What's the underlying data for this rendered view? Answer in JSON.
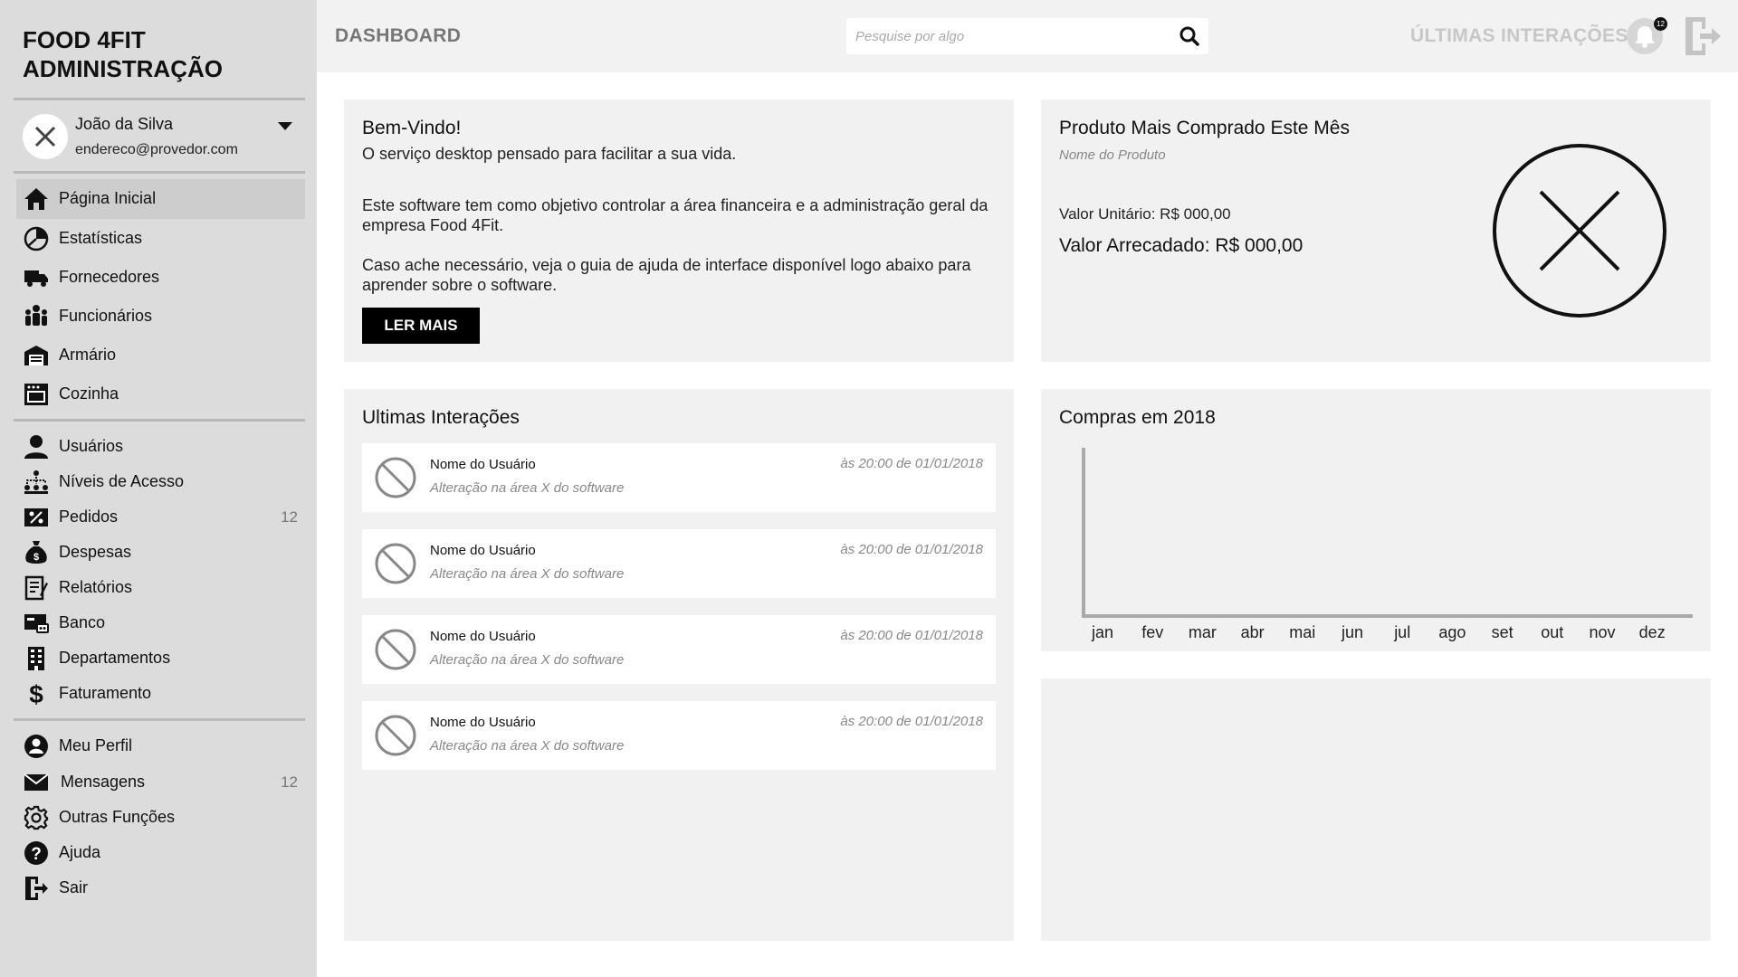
{
  "sidebar": {
    "brand_line1": "FOOD 4FIT",
    "brand_line2": "ADMINISTRAÇÃO",
    "profile": {
      "name": "João da Silva",
      "email": "endereco@provedor.com"
    },
    "group1": [
      {
        "label": "Página Inicial",
        "icon": "home-icon",
        "active": true
      },
      {
        "label": "Estatísticas",
        "icon": "pie-chart-icon"
      },
      {
        "label": "Fornecedores",
        "icon": "truck-icon"
      },
      {
        "label": "Funcionários",
        "icon": "people-icon"
      },
      {
        "label": "Armário",
        "icon": "warehouse-icon"
      },
      {
        "label": "Cozinha",
        "icon": "stove-icon"
      }
    ],
    "group2": [
      {
        "label": "Usuários",
        "icon": "user-icon"
      },
      {
        "label": "Níveis de Acesso",
        "icon": "hierarchy-icon"
      },
      {
        "label": "Pedidos",
        "icon": "percent-icon",
        "count": "12"
      },
      {
        "label": "Despesas",
        "icon": "money-bag-icon"
      },
      {
        "label": "Relatórios",
        "icon": "report-icon"
      },
      {
        "label": "Banco",
        "icon": "card-icon"
      },
      {
        "label": "Departamentos",
        "icon": "building-icon"
      },
      {
        "label": "Faturamento",
        "icon": "dollar-icon"
      }
    ],
    "group3": [
      {
        "label": "Meu Perfil",
        "icon": "profile-icon"
      },
      {
        "label": "Mensagens",
        "icon": "mail-icon",
        "count": "12"
      },
      {
        "label": "Outras Funções",
        "icon": "gear-icon"
      },
      {
        "label": "Ajuda",
        "icon": "help-icon"
      },
      {
        "label": "Sair",
        "icon": "exit-icon"
      }
    ]
  },
  "header": {
    "title": "DASHBOARD",
    "search_placeholder": "Pesquise por algo",
    "right_label": "ÚLTIMAS INTERAÇÕES",
    "notification_count": "12"
  },
  "welcome": {
    "title": "Bem-Vindo!",
    "subtitle": "O serviço desktop pensado para facilitar a sua vida.",
    "para1": "Este software tem como objetivo controlar a área financeira e a administração geral da empresa Food 4Fit.",
    "para2": "Caso ache necessário, veja o guia de ajuda de interface disponível logo abaixo para aprender sobre o software.",
    "button": "LER MAIS"
  },
  "product": {
    "title": "Produto Mais Comprado Este Mês",
    "name": "Nome do Produto",
    "unit_value": "Valor Unitário: R$ 000,00",
    "total_value": "Valor Arrecadado: R$ 000,00"
  },
  "interactions": {
    "title": "Ultimas Interações",
    "items": [
      {
        "user": "Nome do Usuário",
        "desc": "Alteração na área X do software",
        "time": "às 20:00 de 01/01/2018"
      },
      {
        "user": "Nome do Usuário",
        "desc": "Alteração na área X do software",
        "time": "às 20:00 de 01/01/2018"
      },
      {
        "user": "Nome do Usuário",
        "desc": "Alteração na área X do software",
        "time": "às 20:00 de 01/01/2018"
      },
      {
        "user": "Nome do Usuário",
        "desc": "Alteração na área X do software",
        "time": "às 20:00 de 01/01/2018"
      }
    ]
  },
  "chart_data": {
    "type": "line",
    "title": "Compras em 2018",
    "categories": [
      "jan",
      "fev",
      "mar",
      "abr",
      "mai",
      "jun",
      "jul",
      "ago",
      "set",
      "out",
      "nov",
      "dez"
    ],
    "series": [],
    "xlabel": "",
    "ylabel": "",
    "grid": false,
    "axis_color": "#aaaaaa"
  },
  "colors": {
    "sidebar_bg": "#dcdcdc",
    "panel_bg": "#f1f1f1",
    "accent": "#000000"
  }
}
